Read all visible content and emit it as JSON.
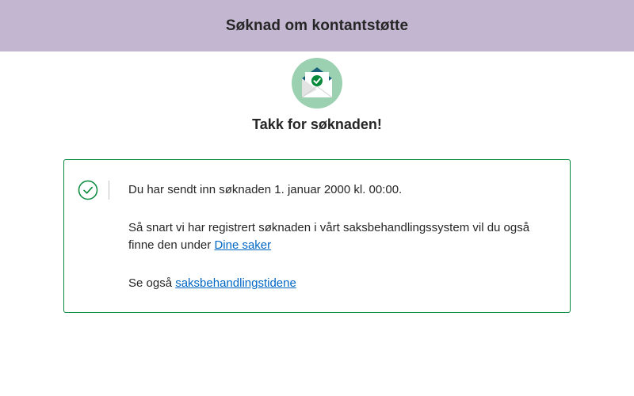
{
  "header": {
    "title": "Søknad om kontantstøtte"
  },
  "illustration": {
    "icon": "envelope-check-icon",
    "circle_color": "#9bd0b0",
    "flap_color": "#1a5e7a",
    "check_color": "#06893a"
  },
  "receipt": {
    "heading": "Takk for søknaden!"
  },
  "alert": {
    "icon": "check-circle-icon",
    "border_color": "#06893a",
    "sent_text": "Du har sendt inn søknaden 1. januar 2000 kl. 00:00.",
    "registered_text": "Så snart vi har registrert søknaden i vårt saksbehandlingssystem vil du også finne den under",
    "registered_link": "Dine saker",
    "see_also_text": "Se også",
    "see_also_link": "saksbehandlingstidene"
  }
}
